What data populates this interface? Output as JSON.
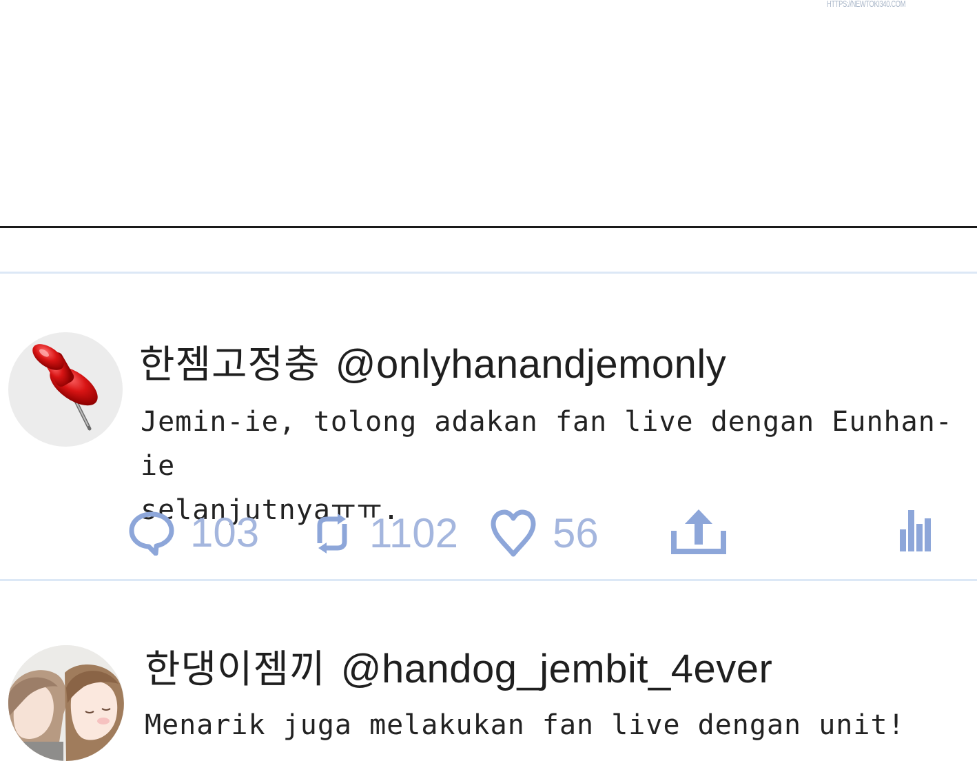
{
  "watermark": "HTTPS://NEWTOKI340.COM",
  "tweets": [
    {
      "display_name": "한젬고정충",
      "handle": "@onlyhanandjemonly",
      "avatar_icon": "pushpin-icon",
      "text": "Jemin-ie, tolong adakan fan live dengan Eunhan-ie\nselanjutnyaㅠㅠ.",
      "replies": "103",
      "retweets": "1102",
      "likes": "56"
    },
    {
      "display_name": "한댕이젬끼",
      "handle": "@handog_jembit_4ever",
      "avatar_icon": "anime-couple-avatar",
      "text": "Menarik juga melakukan fan live dengan unit!"
    }
  ],
  "colors": {
    "action_icon": "#8da6d9",
    "action_count": "#a4b6de",
    "divider": "#dce8f6"
  }
}
